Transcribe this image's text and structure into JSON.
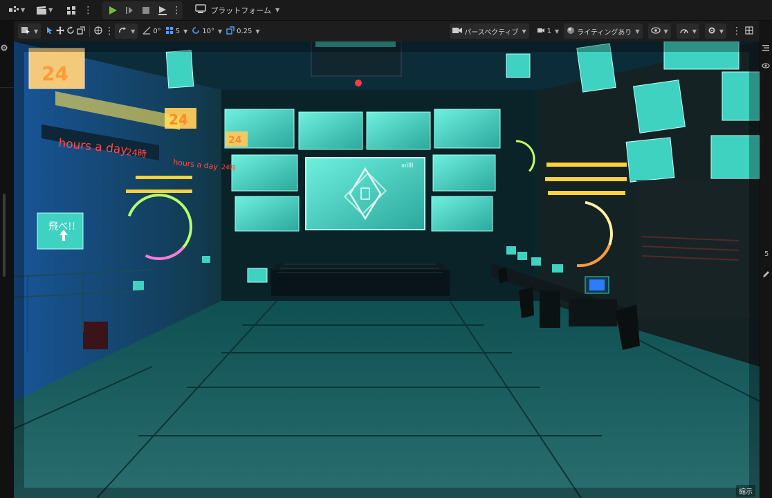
{
  "toolbar": {
    "platform_label": "プラットフォーム"
  },
  "viewport_toolbar": {
    "angle_snap": "0°",
    "grid_snap": "5",
    "rotation_snap": "10°",
    "scale_snap": "0.25",
    "view_mode": "パースペクティブ",
    "camera_speed": "1",
    "lighting_mode": "ライティングあり"
  },
  "scene_signs": {
    "hours_left": "hours a day",
    "hours_left_24": "24時",
    "hours_mid": "hours a day",
    "hours_mid_24": "24時",
    "neon_24_a": "24",
    "neon_24_b": "24",
    "neon_24_c": "24",
    "jump_sign": "飛べ!!"
  },
  "right_panel": {
    "number": "5"
  },
  "corner_label": "縮示",
  "colors": {
    "toolbar_bg": "#1a1a1a",
    "play_green": "#6fbf3c",
    "screen_teal": "#3fd2c0",
    "neon_yellow": "#ffd23a",
    "neon_red": "#ff3b3b"
  }
}
